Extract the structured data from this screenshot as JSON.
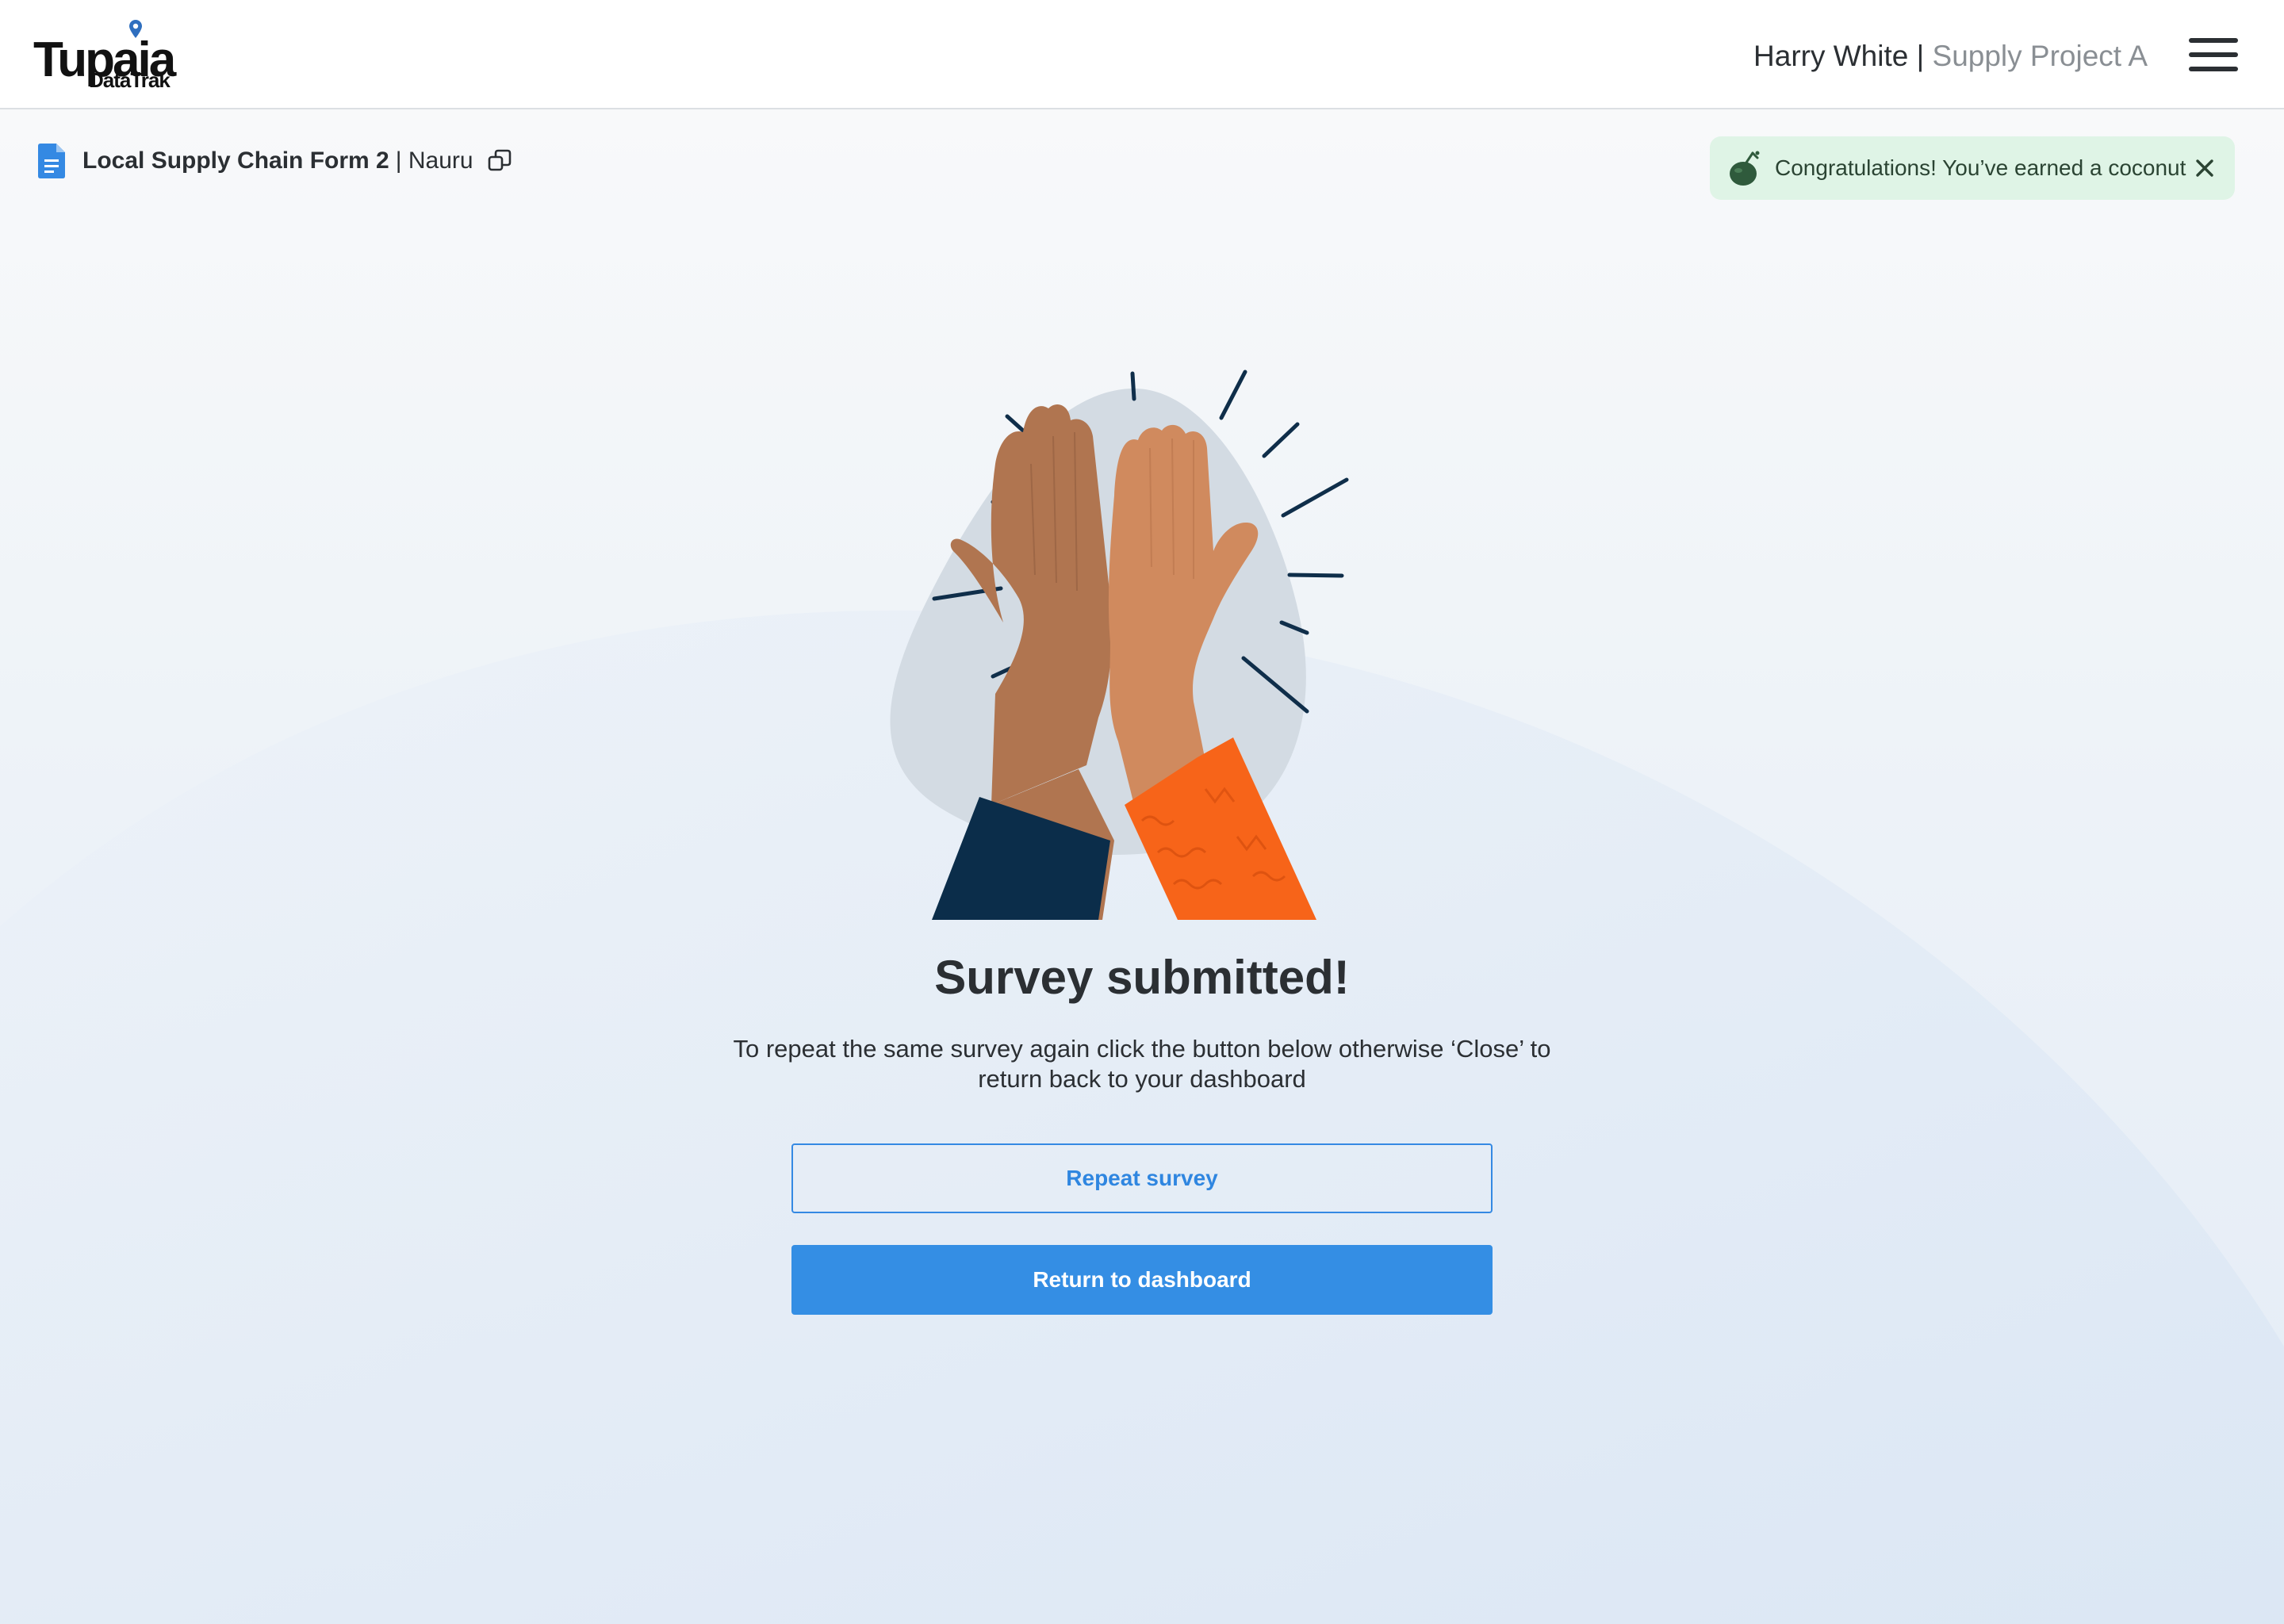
{
  "header": {
    "logo_main": "Tupaia",
    "logo_sub": "DataTrak",
    "user_name": "Harry White",
    "separator": "|",
    "project_name": "Supply Project A"
  },
  "survey": {
    "name": "Local Supply Chain Form 2",
    "country": "| Nauru"
  },
  "toast": {
    "message": "Congratulations! You’ve earned a coconut",
    "icon": "coconut-icon"
  },
  "main": {
    "heading": "Survey submitted!",
    "message": "To repeat the same survey again click the button below otherwise ‘Close’ to return back to your dashboard",
    "repeat_button": "Repeat survey",
    "return_button": "Return to dashboard"
  },
  "colors": {
    "primary": "#348ee4",
    "toast_bg": "#dff4e6",
    "text": "#2b2f33",
    "muted": "#8a8f94"
  }
}
